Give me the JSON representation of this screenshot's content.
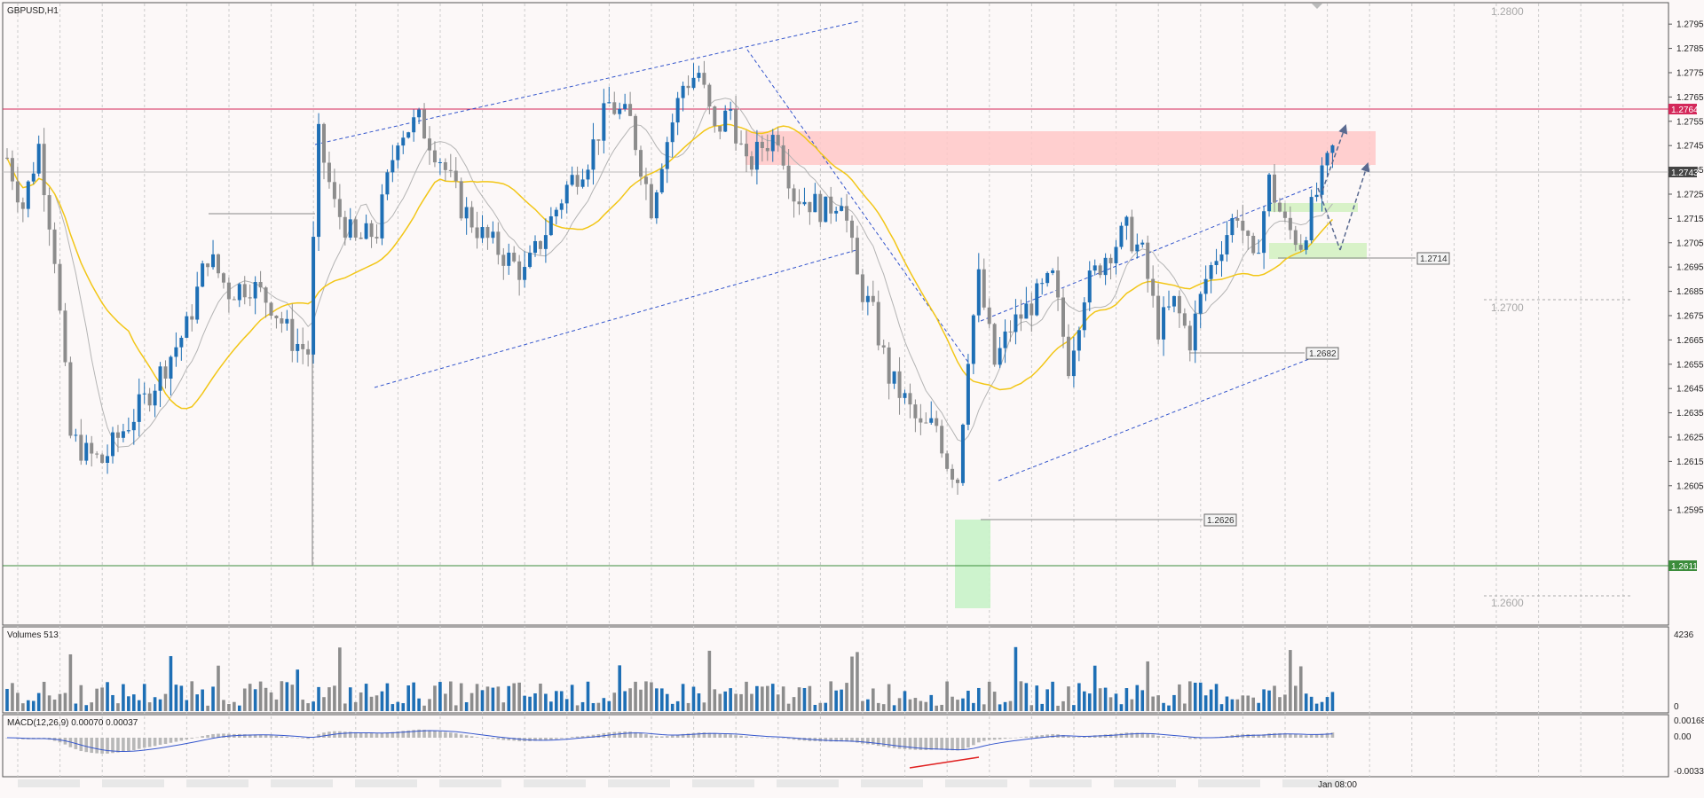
{
  "header": {
    "symbol": "GBPUSD,H1"
  },
  "colors": {
    "bull": "#1e6fb5",
    "bear": "#8c8c8c",
    "ma_slow": "#f2c617",
    "ma_fast": "#b4b4b4",
    "resistance": "#d4285a",
    "support": "#3c8c3c",
    "zone": "#ffc8c8",
    "buyzone": "#c8f2c8",
    "channel": "#3355cc",
    "projection": "#5a6a90",
    "divergence": "#e02020"
  },
  "levels": {
    "resistance_tag": "1.2764",
    "current_tag": "1.2743",
    "support_tag": "1.2611",
    "label_2714": "1.2714",
    "label_2682": "1.2682",
    "label_2626": "1.2626",
    "round_2800": "1.2800",
    "round_2700": "1.2700",
    "round_2600": "1.2600"
  },
  "volume_panel": {
    "title": "Volumes 513",
    "max_label": "4236",
    "zero_label": "0"
  },
  "macd_panel": {
    "title": "MACD(12,26,9) 0.00070 0.00037",
    "top_label": "0.00168",
    "zero_label": "0.00",
    "bottom_label": "-0.00332"
  },
  "time_axis": {
    "last_label": "Jan 08:00"
  },
  "chart_data": {
    "type": "line",
    "title": "GBPUSD,H1",
    "note": "candlestick price chart with volume and MACD sub-panels",
    "y_axis_ticks": [
      "1.2795",
      "1.2785",
      "1.2775",
      "1.2765",
      "1.2755",
      "1.2745",
      "1.2735",
      "1.2725",
      "1.2715",
      "1.2705",
      "1.2695",
      "1.2685",
      "1.2675",
      "1.2665",
      "1.2655",
      "1.2645",
      "1.2635",
      "1.2625",
      "1.2615",
      "1.2605",
      "1.2595"
    ],
    "ylim": [
      1.2592,
      1.2802
    ],
    "price_path": [
      {
        "x": 0,
        "y": 1.274
      },
      {
        "x": 3,
        "y": 1.272
      },
      {
        "x": 6,
        "y": 1.2745
      },
      {
        "x": 9,
        "y": 1.27
      },
      {
        "x": 12,
        "y": 1.2625
      },
      {
        "x": 15,
        "y": 1.2618
      },
      {
        "x": 18,
        "y": 1.2615
      },
      {
        "x": 22,
        "y": 1.2628
      },
      {
        "x": 26,
        "y": 1.264
      },
      {
        "x": 30,
        "y": 1.2655
      },
      {
        "x": 34,
        "y": 1.267
      },
      {
        "x": 38,
        "y": 1.27
      },
      {
        "x": 42,
        "y": 1.2685
      },
      {
        "x": 46,
        "y": 1.2688
      },
      {
        "x": 50,
        "y": 1.268
      },
      {
        "x": 54,
        "y": 1.2665
      },
      {
        "x": 57,
        "y": 1.266
      },
      {
        "x": 59,
        "y": 1.2748
      },
      {
        "x": 62,
        "y": 1.272
      },
      {
        "x": 66,
        "y": 1.2705
      },
      {
        "x": 70,
        "y": 1.271
      },
      {
        "x": 74,
        "y": 1.275
      },
      {
        "x": 78,
        "y": 1.2755
      },
      {
        "x": 82,
        "y": 1.274
      },
      {
        "x": 86,
        "y": 1.272
      },
      {
        "x": 90,
        "y": 1.2708
      },
      {
        "x": 94,
        "y": 1.27
      },
      {
        "x": 98,
        "y": 1.2692
      },
      {
        "x": 102,
        "y": 1.271
      },
      {
        "x": 106,
        "y": 1.2728
      },
      {
        "x": 110,
        "y": 1.274
      },
      {
        "x": 114,
        "y": 1.2762
      },
      {
        "x": 118,
        "y": 1.2755
      },
      {
        "x": 122,
        "y": 1.272
      },
      {
        "x": 124,
        "y": 1.274
      },
      {
        "x": 128,
        "y": 1.277
      },
      {
        "x": 131,
        "y": 1.2775
      },
      {
        "x": 134,
        "y": 1.275
      },
      {
        "x": 137,
        "y": 1.276
      },
      {
        "x": 140,
        "y": 1.2735
      },
      {
        "x": 143,
        "y": 1.2745
      },
      {
        "x": 146,
        "y": 1.275
      },
      {
        "x": 149,
        "y": 1.2725
      },
      {
        "x": 152,
        "y": 1.2722
      },
      {
        "x": 155,
        "y": 1.2718
      },
      {
        "x": 158,
        "y": 1.2725
      },
      {
        "x": 161,
        "y": 1.269
      },
      {
        "x": 164,
        "y": 1.2675
      },
      {
        "x": 167,
        "y": 1.265
      },
      {
        "x": 170,
        "y": 1.264
      },
      {
        "x": 173,
        "y": 1.2628
      },
      {
        "x": 176,
        "y": 1.263
      },
      {
        "x": 178,
        "y": 1.2615
      },
      {
        "x": 180,
        "y": 1.2608
      },
      {
        "x": 182,
        "y": 1.266
      },
      {
        "x": 184,
        "y": 1.269
      },
      {
        "x": 187,
        "y": 1.2655
      },
      {
        "x": 190,
        "y": 1.267
      },
      {
        "x": 194,
        "y": 1.268
      },
      {
        "x": 198,
        "y": 1.269
      },
      {
        "x": 201,
        "y": 1.2655
      },
      {
        "x": 204,
        "y": 1.2685
      },
      {
        "x": 208,
        "y": 1.27
      },
      {
        "x": 212,
        "y": 1.271
      },
      {
        "x": 215,
        "y": 1.27
      },
      {
        "x": 218,
        "y": 1.267
      },
      {
        "x": 221,
        "y": 1.268
      },
      {
        "x": 224,
        "y": 1.2665
      },
      {
        "x": 227,
        "y": 1.269
      },
      {
        "x": 230,
        "y": 1.2705
      },
      {
        "x": 233,
        "y": 1.2718
      },
      {
        "x": 236,
        "y": 1.2695
      },
      {
        "x": 239,
        "y": 1.273
      },
      {
        "x": 242,
        "y": 1.2712
      },
      {
        "x": 245,
        "y": 1.2705
      },
      {
        "x": 248,
        "y": 1.2725
      },
      {
        "x": 251,
        "y": 1.2743
      }
    ]
  }
}
